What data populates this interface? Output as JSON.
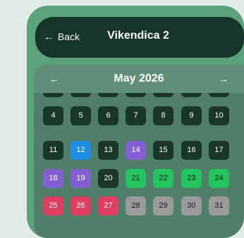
{
  "header": {
    "back_label": "Back",
    "back_arrow": "←",
    "title": "Vikendica 2"
  },
  "calendar": {
    "month_label": "May 2026",
    "prev_arrow": "←",
    "next_arrow": "→",
    "rows": [
      [
        {
          "day": "",
          "status": "plain"
        },
        {
          "day": "",
          "status": "plain"
        },
        {
          "day": "",
          "status": "plain"
        },
        {
          "day": "",
          "status": "plain"
        },
        {
          "day": "",
          "status": "plain"
        },
        {
          "day": "",
          "status": "plain"
        },
        {
          "day": "",
          "status": "plain"
        }
      ],
      [
        {
          "day": "4",
          "status": "plain"
        },
        {
          "day": "5",
          "status": "plain"
        },
        {
          "day": "6",
          "status": "plain"
        },
        {
          "day": "7",
          "status": "plain"
        },
        {
          "day": "8",
          "status": "plain"
        },
        {
          "day": "9",
          "status": "plain"
        },
        {
          "day": "10",
          "status": "plain"
        }
      ],
      [
        {
          "day": "11",
          "status": "plain"
        },
        {
          "day": "12",
          "status": "blue"
        },
        {
          "day": "13",
          "status": "plain"
        },
        {
          "day": "14",
          "status": "purple"
        },
        {
          "day": "15",
          "status": "plain"
        },
        {
          "day": "16",
          "status": "plain"
        },
        {
          "day": "17",
          "status": "plain"
        }
      ],
      [
        {
          "day": "18",
          "status": "purple"
        },
        {
          "day": "19",
          "status": "purple"
        },
        {
          "day": "20",
          "status": "plain"
        },
        {
          "day": "21",
          "status": "green"
        },
        {
          "day": "22",
          "status": "green"
        },
        {
          "day": "23",
          "status": "green"
        },
        {
          "day": "24",
          "status": "green"
        }
      ],
      [
        {
          "day": "25",
          "status": "red"
        },
        {
          "day": "26",
          "status": "red"
        },
        {
          "day": "27",
          "status": "red"
        },
        {
          "day": "28",
          "status": "gray"
        },
        {
          "day": "29",
          "status": "gray"
        },
        {
          "day": "30",
          "status": "gray"
        },
        {
          "day": "31",
          "status": "gray"
        }
      ]
    ]
  },
  "colors": {
    "page_background": "#e3ebe6",
    "frame": "#5aa17c",
    "header": "#163427",
    "calendar": "#507f69",
    "calendar_header": "#5f8f79",
    "day_plain": "#1a3628",
    "day_blue": "#1f8fe6",
    "day_purple": "#8560d3",
    "day_green": "#23c35e",
    "day_red": "#e03e60",
    "day_gray": "#9a9a9a"
  }
}
